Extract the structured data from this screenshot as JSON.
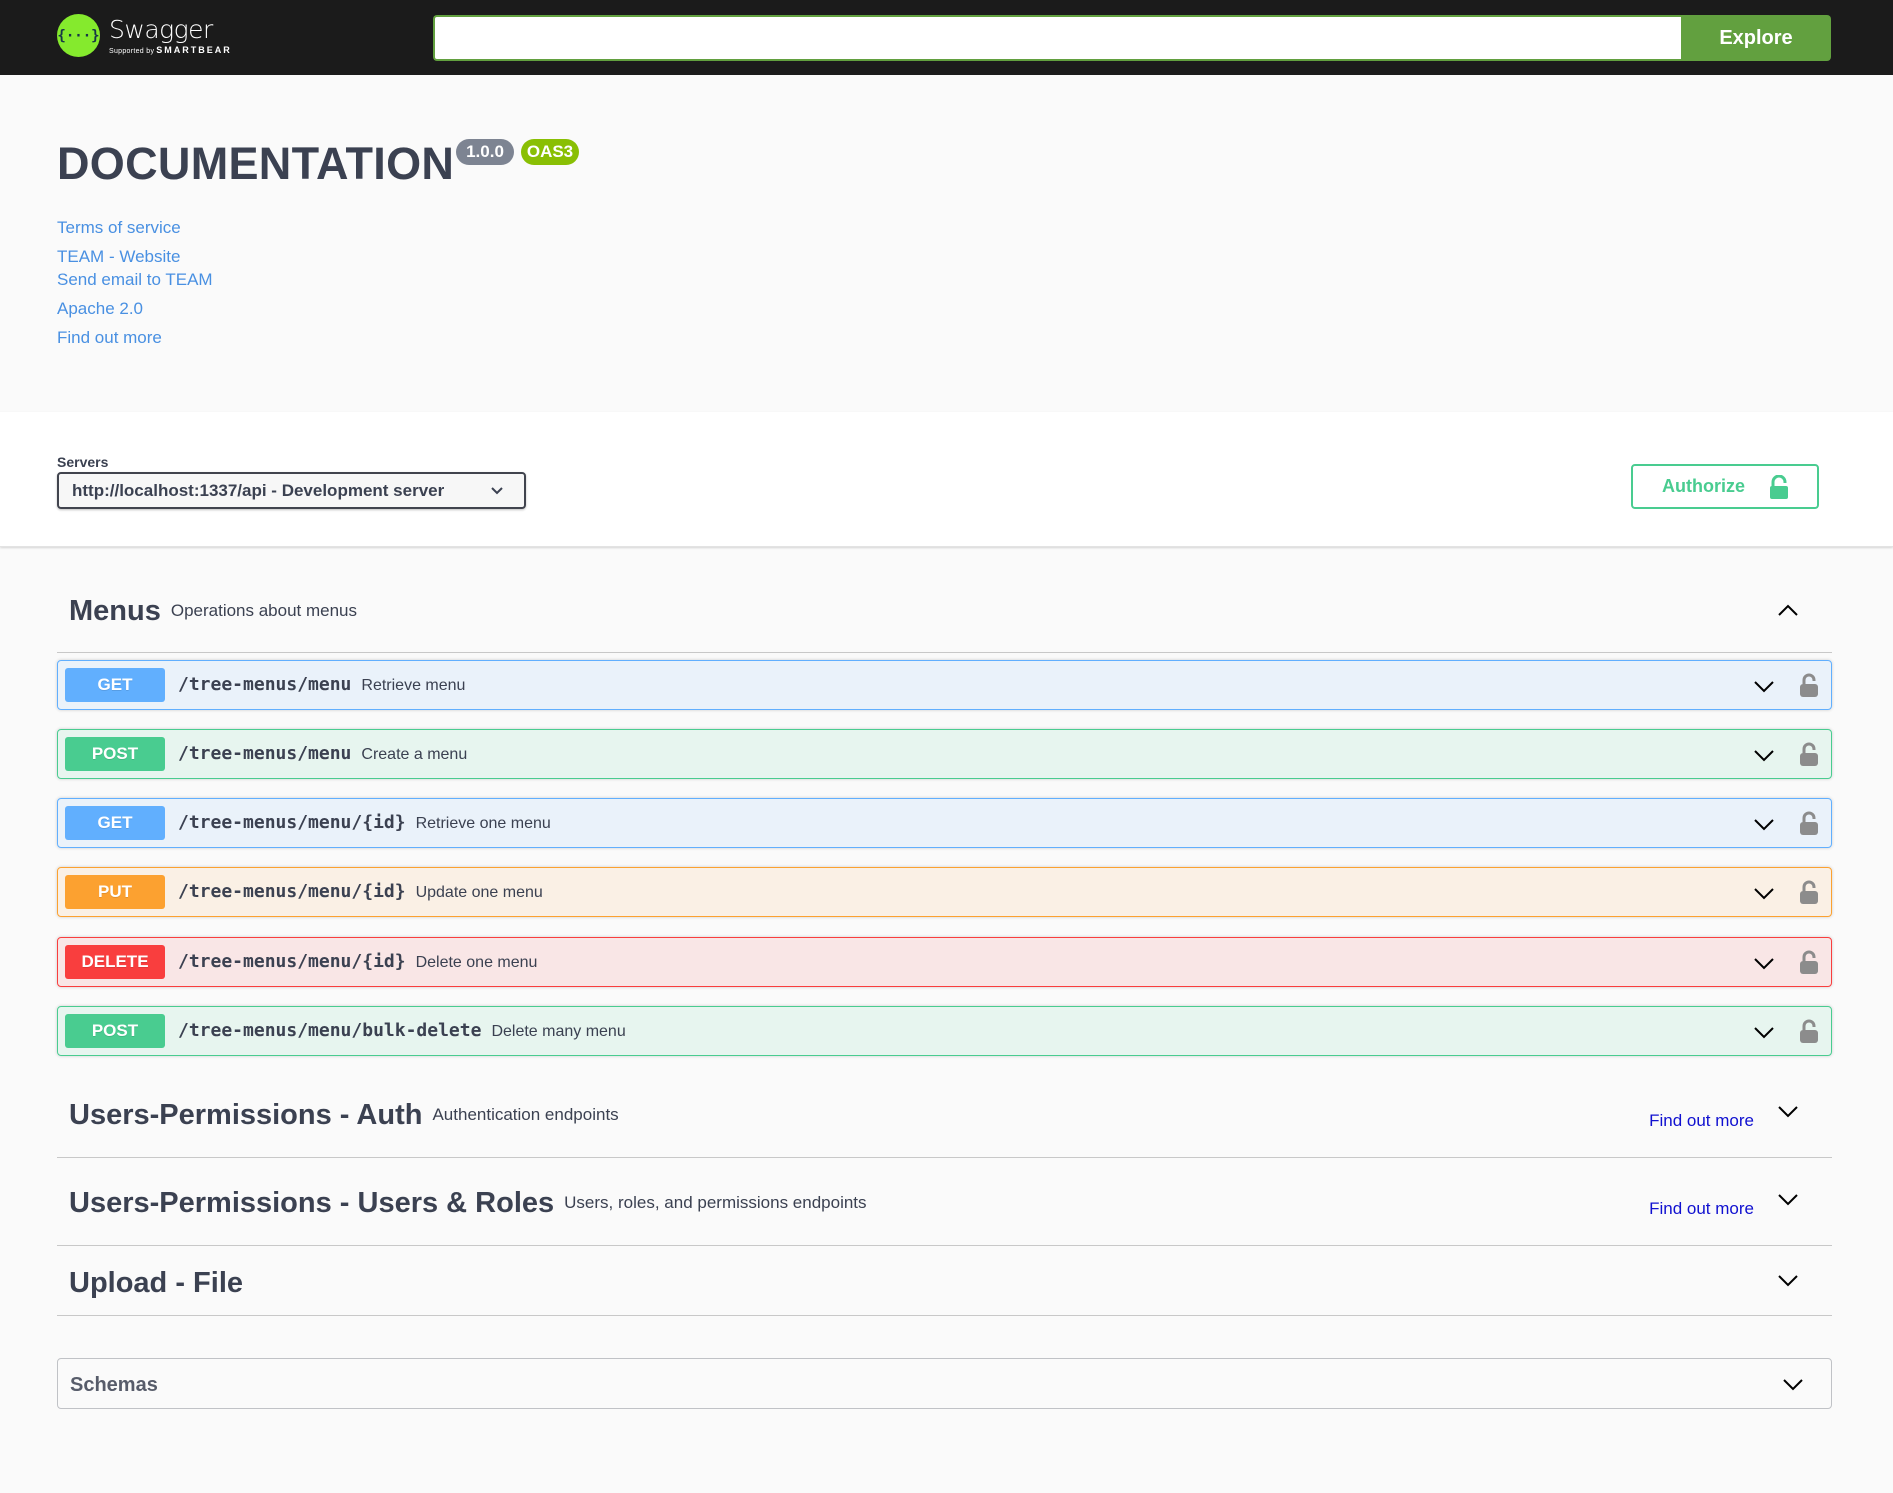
{
  "topbar": {
    "logo_word": "Swagger",
    "logo_sub_prefix": "Supported by",
    "logo_sub_brand": "SMARTBEAR",
    "search_value": "",
    "search_placeholder": "",
    "explore_label": "Explore"
  },
  "info": {
    "title": "DOCUMENTATION",
    "version": "1.0.0",
    "oas_badge": "OAS3",
    "links": [
      {
        "label": "Terms of service"
      },
      {
        "label": "TEAM - Website"
      },
      {
        "label": "Send email to TEAM"
      },
      {
        "label": "Apache 2.0"
      },
      {
        "label": "Find out more"
      }
    ]
  },
  "servers": {
    "label": "Servers",
    "selected": "http://localhost:1337/api - Development server"
  },
  "authorize_label": "Authorize",
  "colors": {
    "get": "#61affe",
    "post": "#49cc90",
    "put": "#fca130",
    "delete": "#f93e3e",
    "explore": "#62a03f",
    "link": "#4990e2"
  },
  "tags": [
    {
      "name": "Menus",
      "description": "Operations about menus",
      "expanded": true,
      "operations": [
        {
          "method": "GET",
          "path": "/tree-menus/menu",
          "summary": "Retrieve menu"
        },
        {
          "method": "POST",
          "path": "/tree-menus/menu",
          "summary": "Create a menu"
        },
        {
          "method": "GET",
          "path": "/tree-menus/menu/{id}",
          "summary": "Retrieve one menu"
        },
        {
          "method": "PUT",
          "path": "/tree-menus/menu/{id}",
          "summary": "Update one menu"
        },
        {
          "method": "DELETE",
          "path": "/tree-menus/menu/{id}",
          "summary": "Delete one menu"
        },
        {
          "method": "POST",
          "path": "/tree-menus/menu/bulk-delete",
          "summary": "Delete many menu"
        }
      ]
    },
    {
      "name": "Users-Permissions - Auth",
      "description": "Authentication endpoints",
      "link": "Find out more",
      "expanded": false
    },
    {
      "name": "Users-Permissions - Users & Roles",
      "description": "Users, roles, and permissions endpoints",
      "link": "Find out more",
      "expanded": false
    },
    {
      "name": "Upload - File",
      "description": "",
      "expanded": false
    }
  ],
  "schemas_label": "Schemas"
}
